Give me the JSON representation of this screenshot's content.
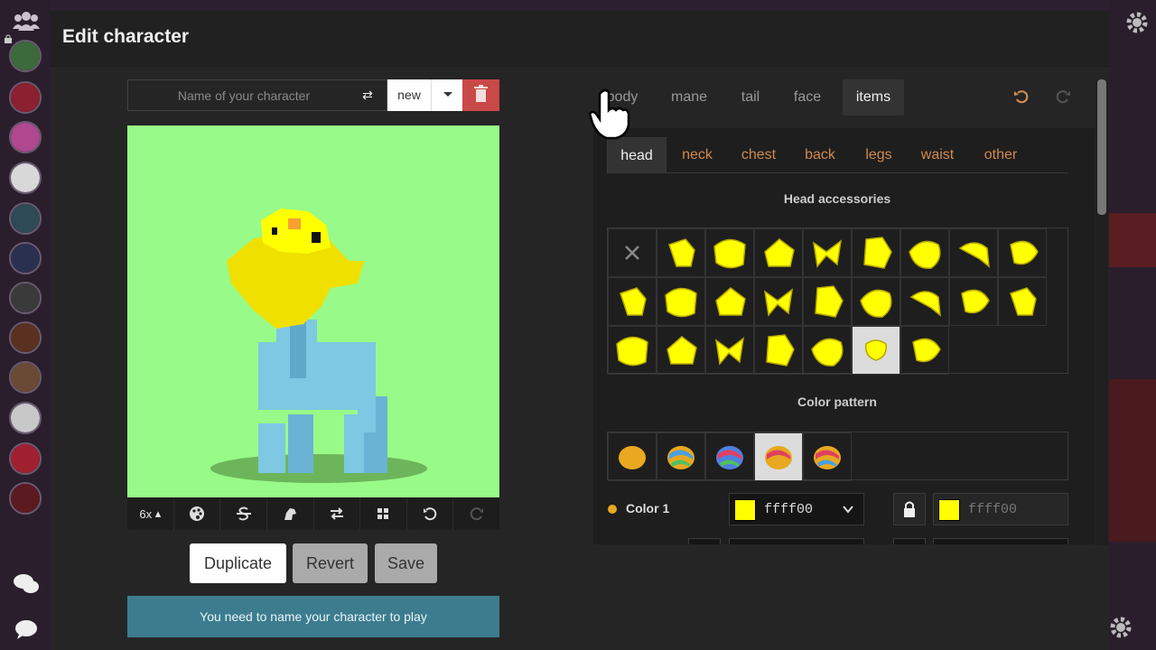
{
  "modal": {
    "title": "Edit character"
  },
  "name_row": {
    "placeholder": "Name of your character",
    "swap_glyph": "⇄",
    "new_label": "new"
  },
  "toolbar": {
    "zoom_label": "6x"
  },
  "actions": {
    "duplicate": "Duplicate",
    "revert": "Revert",
    "save": "Save"
  },
  "notice": "You need to name your character to play",
  "main_tabs": [
    "body",
    "mane",
    "tail",
    "face",
    "items"
  ],
  "active_main_tab": "items",
  "sub_tabs": [
    "head",
    "neck",
    "chest",
    "back",
    "legs",
    "waist",
    "other"
  ],
  "active_sub_tab": "head",
  "head_accessories": {
    "title": "Head accessories",
    "item_count": 24,
    "selected_index": 22
  },
  "color_pattern": {
    "title": "Color pattern",
    "pattern_count": 5,
    "selected_index": 3
  },
  "color1": {
    "label": "Color 1",
    "value": "ffff00",
    "locked_value": "ffff00"
  },
  "colors": {
    "yellow": "#ffff00",
    "canvas_bg": "#98fa88",
    "accent": "#d08a4e",
    "delete": "#c94848",
    "notice": "#3d7c8e"
  }
}
